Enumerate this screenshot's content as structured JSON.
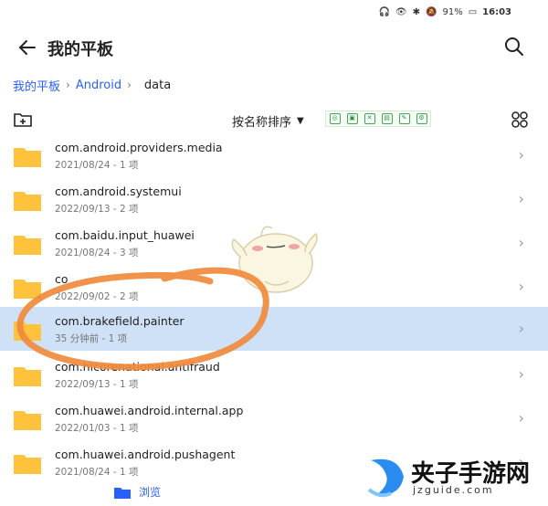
{
  "status": {
    "battery": "91%",
    "time": "16:03"
  },
  "header": {
    "title": "我的平板"
  },
  "breadcrumb": {
    "items": [
      "我的平板",
      "Android",
      "data"
    ]
  },
  "toolbar": {
    "sort_label": "按名称排序"
  },
  "files": [
    {
      "name": "com.android.providers.media",
      "meta": "2021/08/24 - 1 项",
      "selected": false
    },
    {
      "name": "com.android.systemui",
      "meta": "2022/09/13 - 2 项",
      "selected": false
    },
    {
      "name": "com.baidu.input_huawei",
      "meta": "2021/08/24 - 3 项",
      "selected": false
    },
    {
      "name": "co",
      "meta": "2022/09/02 - 2 项",
      "selected": false
    },
    {
      "name": "com.brakefield.painter",
      "meta": "35 分钟前 - 1 项",
      "selected": true
    },
    {
      "name": "com.hicorenational.antifraud",
      "meta": "2022/09/13 - 1 项",
      "selected": false
    },
    {
      "name": "com.huawei.android.internal.app",
      "meta": "2022/01/03 - 1 项",
      "selected": false
    },
    {
      "name": "com.huawei.android.pushagent",
      "meta": "2021/08/24 - 1 项",
      "selected": false
    }
  ],
  "bottom_nav": {
    "browse_label": "浏览"
  },
  "watermark": {
    "text": "夹子手游网",
    "sub": "jzguide.com"
  },
  "colors": {
    "accent": "#2a5fff",
    "folder": "#ffc23d",
    "selected_row": "#cfe1f6",
    "annotation": "#f08a3c"
  }
}
